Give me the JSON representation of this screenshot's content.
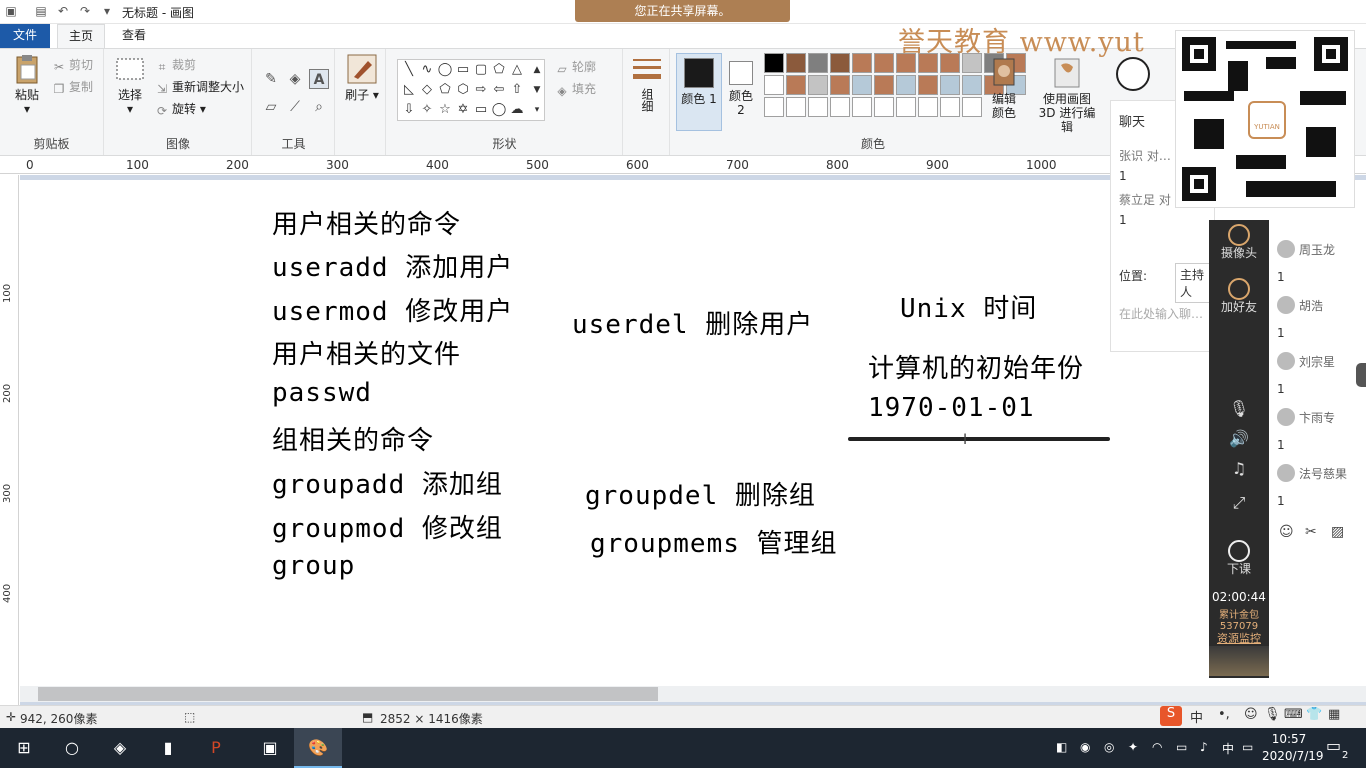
{
  "window": {
    "title": "无标题 - 画图"
  },
  "share_banner": "您正在共享屏幕。",
  "watermark": "誉天教育 www.yut",
  "tabs": {
    "file": "文件",
    "home": "主页",
    "view": "查看"
  },
  "ribbon": {
    "clipboard": {
      "paste": "粘贴",
      "cut": "剪切",
      "copy": "复制",
      "label": "剪贴板"
    },
    "image": {
      "select": "选择",
      "crop": "裁剪",
      "resize": "重新调整大小",
      "rotate": "旋转",
      "label": "图像"
    },
    "tools": {
      "label": "工具"
    },
    "brushes": {
      "label": "刷子"
    },
    "shapes": {
      "outline": "轮廓",
      "fill": "填充",
      "label": "形状"
    },
    "size": {
      "label": "组细"
    },
    "color1": "颜色 1",
    "color2": "颜色 2",
    "colors_label": "颜色",
    "edit_colors": "编辑颜色",
    "paint3d": "使用画图 3D 进行编辑"
  },
  "palette": {
    "row1": [
      "#000000",
      "#8b5a3c",
      "#7f7f7f",
      "#8b5a3c",
      "#b97a57",
      "#b97a57",
      "#b97a57",
      "#b97a57",
      "#b97a57",
      "#c3c3c3",
      "#7f7f7f",
      "#b97a57"
    ],
    "row2": [
      "#ffffff",
      "#b97a57",
      "#c3c3c3",
      "#b97a57",
      "#b5c9d8",
      "#b97a57",
      "#b5c9d8",
      "#b97a57",
      "#b5c9d8",
      "#b5c9d8",
      "#b97a57",
      "#b5c9d8"
    ],
    "row3": [
      "#ffffff",
      "#ffffff",
      "#ffffff",
      "#ffffff",
      "#ffffff",
      "#ffffff",
      "#ffffff",
      "#ffffff",
      "#ffffff",
      "#ffffff"
    ]
  },
  "ruler": [
    "0",
    "100",
    "200",
    "300",
    "400",
    "500",
    "600",
    "700",
    "800",
    "900",
    "1000"
  ],
  "vruler": [
    "100",
    "200",
    "300",
    "400"
  ],
  "canvas_text": {
    "l1": "用户相关的命令",
    "l2": "useradd 添加用户",
    "l3": "usermod 修改用户",
    "l4": "用户相关的文件",
    "l5": "passwd",
    "l6": "组相关的命令",
    "l7": "groupadd 添加组",
    "l8": "groupmod 修改组",
    "l9": "group",
    "r1": "userdel  删除用户",
    "r2": "Unix 时间",
    "r3": "计算机的初始年份",
    "r4": "1970-01-01",
    "r5": "groupdel  删除组",
    "r6": "groupmems  管理组"
  },
  "status": {
    "coords": "942, 260像素",
    "size": "2852 × 1416像素"
  },
  "chat": {
    "title": "聊天",
    "u1": "张识 对…",
    "c1": "1",
    "u2": "蔡立足 对",
    "c2": "1",
    "position_label": "位置:",
    "position_value": "主持人",
    "input_placeholder": "在此处输入聊…"
  },
  "sidebar": {
    "camera": "摄像头",
    "add_friend": "加好友",
    "end_class": "下课",
    "timer": "02:00:44",
    "gifts": "累计金包",
    "gift_count": "537079",
    "monitor": "资源监控"
  },
  "users": [
    {
      "name": "周玉龙",
      "count": "1"
    },
    {
      "name": "胡浩",
      "count": "1"
    },
    {
      "name": "刘宗星",
      "count": "1"
    },
    {
      "name": "卞雨专",
      "count": "1"
    },
    {
      "name": "法号慈果",
      "count": "1"
    }
  ],
  "taskbar": {
    "time": "10:57",
    "date": "2020/7/19",
    "ime": "中",
    "notif": "2"
  }
}
